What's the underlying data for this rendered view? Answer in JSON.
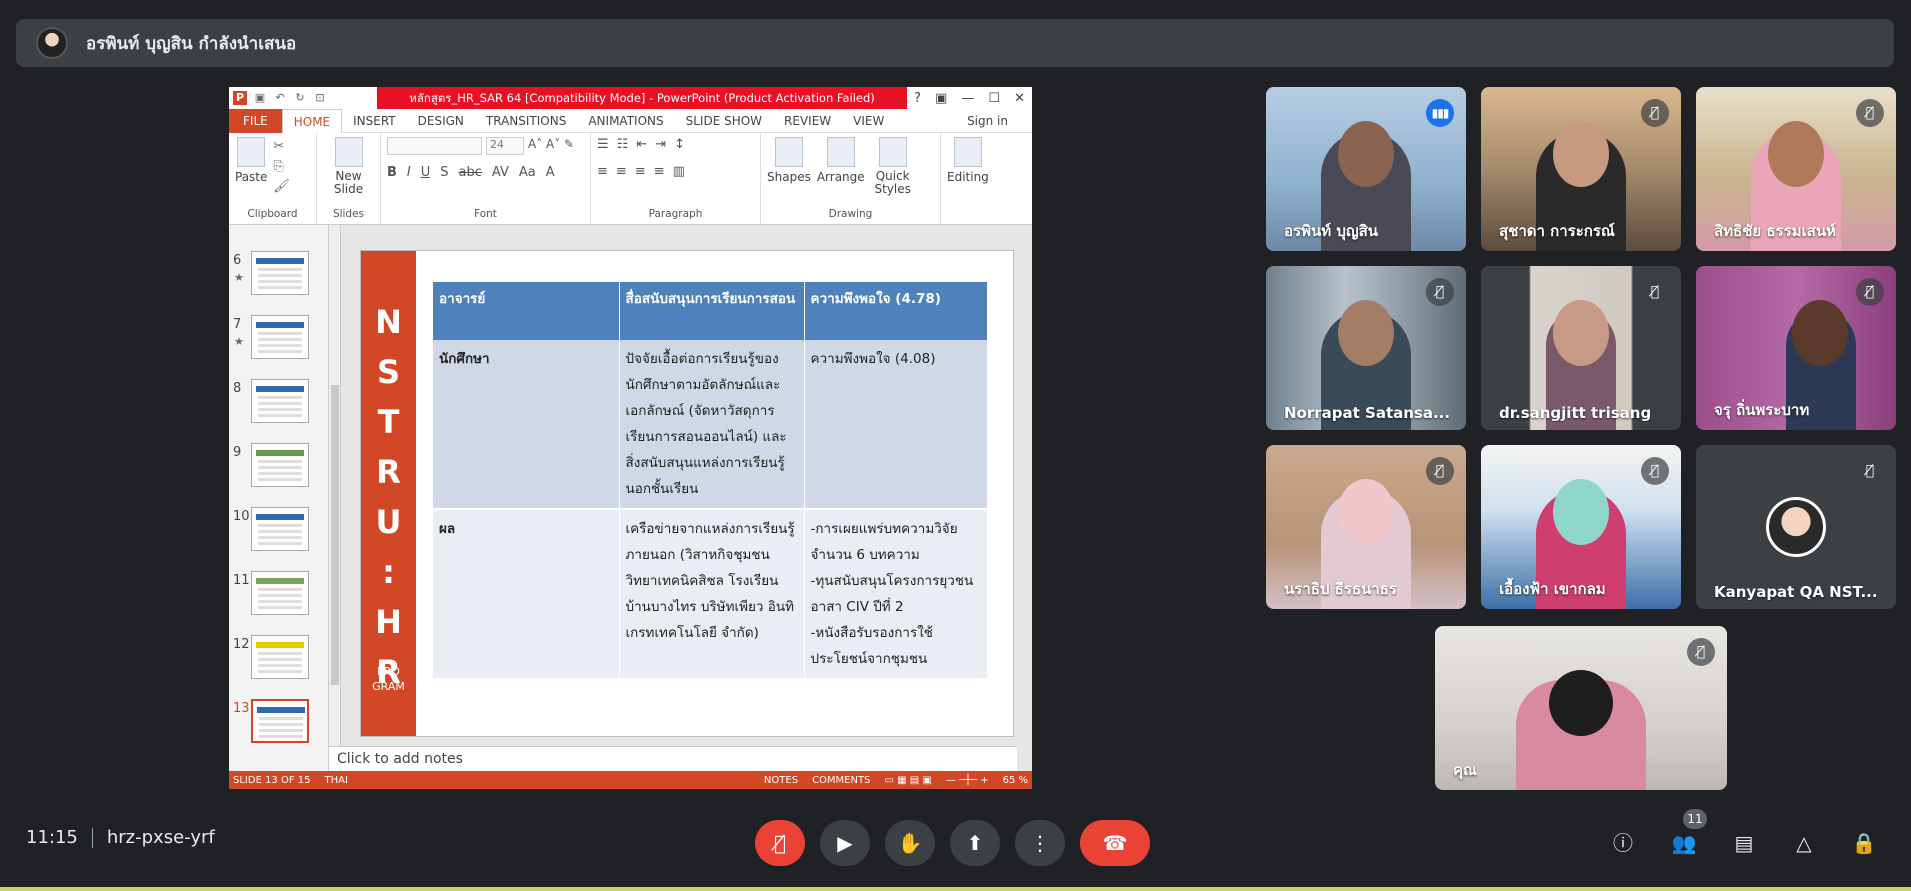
{
  "banner": {
    "presenter_text": "อรพินท์ บุญสิน กำลังนำเสนอ"
  },
  "ppt": {
    "window_title": "หลักสูตร_HR_SAR 64 [Compatibility Mode] - PowerPoint (Product Activation Failed)",
    "window_controls": [
      "?",
      "▣",
      "—",
      "☐",
      "✕"
    ],
    "tabs": [
      "FILE",
      "HOME",
      "INSERT",
      "DESIGN",
      "TRANSITIONS",
      "ANIMATIONS",
      "SLIDE SHOW",
      "REVIEW",
      "VIEW"
    ],
    "sign_in": "Sign in",
    "ribbon": {
      "clipboard": {
        "paste": "Paste",
        "label": "Clipboard"
      },
      "slides": {
        "new_slide": "New Slide",
        "label": "Slides"
      },
      "font": {
        "size": "24",
        "label": "Font",
        "format_buttons": [
          "B",
          "I",
          "U",
          "S",
          "abc",
          "AV",
          "Aa",
          "A"
        ]
      },
      "paragraph": {
        "label": "Paragraph"
      },
      "drawing": {
        "shapes": "Shapes",
        "arrange": "Arrange",
        "quick_styles": "Quick Styles",
        "label": "Drawing"
      },
      "editing": {
        "label": "Editing"
      }
    },
    "thumbnails": [
      {
        "num": "6",
        "star": "★"
      },
      {
        "num": "7",
        "star": "★"
      },
      {
        "num": "8",
        "star": ""
      },
      {
        "num": "9",
        "star": ""
      },
      {
        "num": "10",
        "star": ""
      },
      {
        "num": "11",
        "star": ""
      },
      {
        "num": "12",
        "star": ""
      },
      {
        "num": "13",
        "star": ""
      }
    ],
    "slide": {
      "band_letters": "N S T R U : H R",
      "band_program": "PRO GRAM",
      "table": {
        "headers": [
          "อาจารย์",
          "สื่อสนับสนุนการเรียนการสอน",
          "ความพึงพอใจ (4.78)"
        ],
        "row1": [
          "นักศึกษา",
          "ปัจจัยเอื้อต่อการเรียนรู้ของนักศึกษาตามอัตลักษณ์และเอกลักษณ์ (จัดหาวัสดุการเรียนการสอนออนไลน์) และสิ่งสนับสนุนแหล่งการเรียนรู้นอกชั้นเรียน",
          "ความพึงพอใจ (4.08)"
        ],
        "row2": [
          "ผล",
          "เครือข่ายจากแหล่งการเรียนรู้ภายนอก (วิสาหกิจชุมชนวิทยาเทคนิคสิชล โรงเรียนบ้านบางไทร บริษัทเพียว อินทิเกรทเทคโนโลยี จำกัด)",
          "-การเผยแพร่บทความวิจัย จำนวน 6 บทความ\n-ทุนสนับสนุนโครงการยุวชนอาสา CIV ปีที่ 2\n-หนังสือรับรองการใช้ประโยชน์จากชุมชน"
        ]
      }
    },
    "notes": "Click to add notes",
    "status": {
      "slide": "SLIDE 13 OF 15",
      "lang": "THAI",
      "notes": "NOTES",
      "comments": "COMMENTS",
      "zoom": "65 %"
    }
  },
  "participants": [
    {
      "name": "อรพินท์ บุญสิน",
      "speaking": true,
      "muted": false
    },
    {
      "name": "สุชาดา การะกรณ์",
      "speaking": false,
      "muted": true
    },
    {
      "name": "สิทธิชัย ธรรมเสนห์",
      "speaking": false,
      "muted": true
    },
    {
      "name": "Norrapat Satansa...",
      "speaking": false,
      "muted": true
    },
    {
      "name": "dr.sangjitt trisang",
      "speaking": false,
      "muted": true
    },
    {
      "name": "จรุ ถิ่นพระบาท",
      "speaking": false,
      "muted": true
    },
    {
      "name": "นราธิป ธีรธนาธร",
      "speaking": false,
      "muted": true
    },
    {
      "name": "เอื้องฟ้า เขากลม",
      "speaking": false,
      "muted": true
    },
    {
      "name": "Kanyapat QA NST...",
      "speaking": false,
      "muted": true
    },
    {
      "name": "คุณ",
      "speaking": false,
      "muted": true
    }
  ],
  "meeting": {
    "time": "11:15",
    "code": "hrz-pxse-yrf",
    "participant_count": "11"
  },
  "colors": {
    "meet_bg": "#202124",
    "tile_bg": "#3c4043",
    "ppt_accent": "#d24726",
    "table_header": "#4f81bd",
    "end_call": "#ea4335",
    "speaking_ring": "#8ab4f8"
  },
  "icons": {
    "controls": [
      "mic-off-icon",
      "camera-icon",
      "hand-raise-icon",
      "present-screen-icon",
      "more-options-icon",
      "end-call-icon"
    ],
    "right": [
      "info-icon",
      "people-icon",
      "chat-icon",
      "activities-icon",
      "host-controls-icon"
    ]
  }
}
